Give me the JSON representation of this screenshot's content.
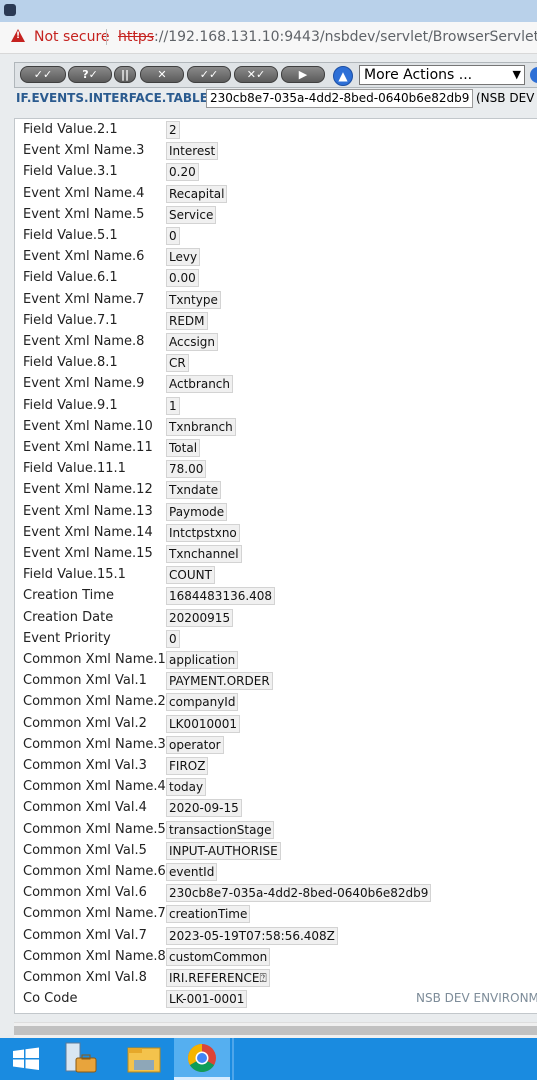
{
  "browser": {
    "security_label": "Not secure",
    "url_scheme": "https",
    "url_rest": "://192.168.131.10:9443/nsbdev/servlet/BrowserServlet"
  },
  "toolbar": {
    "buttons": [
      "✓✓",
      "?✓",
      "||",
      "✕",
      "✓✓",
      "✕✓",
      "▶"
    ],
    "more_actions_label": "More Actions ..."
  },
  "record": {
    "table_name": "IF.EVENTS.INTERFACE.TABLE",
    "id": "230cb8e7-035a-4dd2-8bed-0640b6e82db9",
    "env_tail": "(NSB DEV"
  },
  "fields": [
    {
      "label": "Field Value.2.1",
      "value": "2"
    },
    {
      "label": "Event Xml Name.3",
      "value": "Interest"
    },
    {
      "label": "Field Value.3.1",
      "value": "0.20"
    },
    {
      "label": "Event Xml Name.4",
      "value": "Recapital"
    },
    {
      "label": "Event Xml Name.5",
      "value": "Service"
    },
    {
      "label": "Field Value.5.1",
      "value": "0"
    },
    {
      "label": "Event Xml Name.6",
      "value": "Levy"
    },
    {
      "label": "Field Value.6.1",
      "value": "0.00"
    },
    {
      "label": "Event Xml Name.7",
      "value": "Txntype"
    },
    {
      "label": "Field Value.7.1",
      "value": "REDM"
    },
    {
      "label": "Event Xml Name.8",
      "value": "Accsign"
    },
    {
      "label": "Field Value.8.1",
      "value": "CR"
    },
    {
      "label": "Event Xml Name.9",
      "value": "Actbranch"
    },
    {
      "label": "Field Value.9.1",
      "value": "1"
    },
    {
      "label": "Event Xml Name.10",
      "value": "Txnbranch"
    },
    {
      "label": "Event Xml Name.11",
      "value": "Total"
    },
    {
      "label": "Field Value.11.1",
      "value": "78.00"
    },
    {
      "label": "Event Xml Name.12",
      "value": "Txndate"
    },
    {
      "label": "Event Xml Name.13",
      "value": "Paymode"
    },
    {
      "label": "Event Xml Name.14",
      "value": "Intctpstxno"
    },
    {
      "label": "Event Xml Name.15",
      "value": "Txnchannel"
    },
    {
      "label": "Field Value.15.1",
      "value": "COUNT"
    },
    {
      "label": "Creation Time",
      "value": "1684483136.408"
    },
    {
      "label": "Creation Date",
      "value": "20200915"
    },
    {
      "label": "Event Priority",
      "value": "0"
    },
    {
      "label": "Common Xml Name.1",
      "value": "application"
    },
    {
      "label": "Common Xml Val.1",
      "value": "PAYMENT.ORDER"
    },
    {
      "label": "Common Xml Name.2",
      "value": "companyId"
    },
    {
      "label": "Common Xml Val.2",
      "value": "LK0010001"
    },
    {
      "label": "Common Xml Name.3",
      "value": "operator"
    },
    {
      "label": "Common Xml Val.3",
      "value": "FIROZ"
    },
    {
      "label": "Common Xml Name.4",
      "value": "today"
    },
    {
      "label": "Common Xml Val.4",
      "value": "2020-09-15"
    },
    {
      "label": "Common Xml Name.5",
      "value": "transactionStage"
    },
    {
      "label": "Common Xml Val.5",
      "value": "INPUT-AUTHORISE"
    },
    {
      "label": "Common Xml Name.6",
      "value": "eventId"
    },
    {
      "label": "Common Xml Val.6",
      "value": "230cb8e7-035a-4dd2-8bed-0640b6e82db9"
    },
    {
      "label": "Common Xml Name.7",
      "value": "creationTime"
    },
    {
      "label": "Common Xml Val.7",
      "value": "2023-05-19T07:58:56.408Z"
    },
    {
      "label": "Common Xml Name.8",
      "value": "customCommon"
    },
    {
      "label": "Common Xml Val.8",
      "value": "IRI.REFERENCE⍰"
    },
    {
      "label": "Co Code",
      "value": "LK-001-0001"
    }
  ],
  "footer_env": "NSB DEV ENVIRONM",
  "colors": {
    "accent": "#2b5b8f",
    "warning": "#c5221f",
    "taskbar": "#1a8be0"
  }
}
